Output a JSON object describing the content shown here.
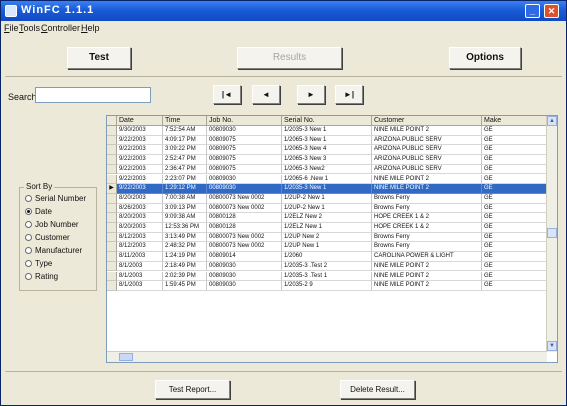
{
  "window": {
    "title": "WinFC 1.1.1"
  },
  "menu": [
    "File",
    "Tools",
    "Controller",
    "Help"
  ],
  "toolbar": {
    "test_label": "Test",
    "results_label": "Results",
    "options_label": "Options"
  },
  "search": {
    "label": "Search",
    "value": ""
  },
  "nav": [
    "|◄",
    "◄",
    "►",
    "►|"
  ],
  "sort": {
    "title": "Sort By",
    "options": [
      {
        "label": "Serial Number",
        "selected": false
      },
      {
        "label": "Date",
        "selected": true
      },
      {
        "label": "Job Number",
        "selected": false
      },
      {
        "label": "Customer",
        "selected": false
      },
      {
        "label": "Manufacturer",
        "selected": false
      },
      {
        "label": "Type",
        "selected": false
      },
      {
        "label": "Rating",
        "selected": false
      }
    ]
  },
  "grid": {
    "columns": [
      "Date",
      "Time",
      "Job No.",
      "Serial No.",
      "Customer",
      "Make"
    ],
    "rows": [
      [
        "9/30/2003",
        "7:52:54 AM",
        "00809030",
        "1/2035-3 New 1",
        "NINE MILE POINT 2",
        "GE"
      ],
      [
        "9/22/2003",
        "4:09:17 PM",
        "00809075",
        "1/2065-3 New 1",
        "ARIZONA PUBLIC SERV",
        "GE"
      ],
      [
        "9/22/2003",
        "3:09:22 PM",
        "00809075",
        "1/2065-3 New 4",
        "ARIZONA PUBLIC SERV",
        "GE"
      ],
      [
        "9/22/2003",
        "2:52:47 PM",
        "00809075",
        "1/2065-3 New 3",
        "ARIZONA PUBLIC SERV",
        "GE"
      ],
      [
        "9/22/2003",
        "2:36:47 PM",
        "00809075",
        "1/2065-3 New2",
        "ARIZONA PUBLIC SERV",
        "GE"
      ],
      [
        "9/22/2003",
        "2:23:07 PM",
        "00809030",
        "1/2065-6 .New 1",
        "NINE MILE POINT 2",
        "GE"
      ],
      [
        "9/22/2003",
        "1:29:12 PM",
        "00809030",
        "1/2035-3 New 1",
        "NINE MILE POINT 2",
        "GE"
      ],
      [
        "8/20/2003",
        "7:00:38 AM",
        "00800073 New 0002",
        "1/2UP-2 New 1",
        "Browns Ferry",
        "GE"
      ],
      [
        "8/26/2003",
        "3:09:13 PM",
        "00800073 New 0002",
        "1/2UP-2 New 1",
        "Browns Ferry",
        "GE"
      ],
      [
        "8/20/2003",
        "9:09:38 AM",
        "00800128",
        "1/2ELZ New 2",
        "HOPE CREEK 1 & 2",
        "GE"
      ],
      [
        "8/20/2003",
        "12:53:36 PM",
        "00800128",
        "1/2ELZ New 1",
        "HOPE CREEK 1 & 2",
        "GE"
      ],
      [
        "8/12/2003",
        "3:13:49 PM",
        "00800073 New 0002",
        "1/2UP New 2",
        "Browns Ferry",
        "GE"
      ],
      [
        "8/12/2003",
        "2:48:32 PM",
        "00800073 New 0002",
        "1/2UP New 1",
        "Browns Ferry",
        "GE"
      ],
      [
        "8/11/2003",
        "1:24:19 PM",
        "00809014",
        "1/2060",
        "CAROLINA POWER & LIGHT",
        "GE"
      ],
      [
        "8/1/2003",
        "2:18:49 PM",
        "00809030",
        "1/2035-3 .Test 2",
        "NINE MILE POINT 2",
        "GE"
      ],
      [
        "8/1/2003",
        "2:02:39 PM",
        "00809030",
        "1/2035-3 .Test 1",
        "NINE MILE POINT 2",
        "GE"
      ],
      [
        "8/1/2003",
        "1:59:45 PM",
        "00809030",
        "1/2035-2 9",
        "NINE MILE POINT 2",
        "GE"
      ]
    ],
    "selected_row": 6
  },
  "bottom": {
    "report_label": "Test Report...",
    "delete_label": "Delete Result..."
  }
}
